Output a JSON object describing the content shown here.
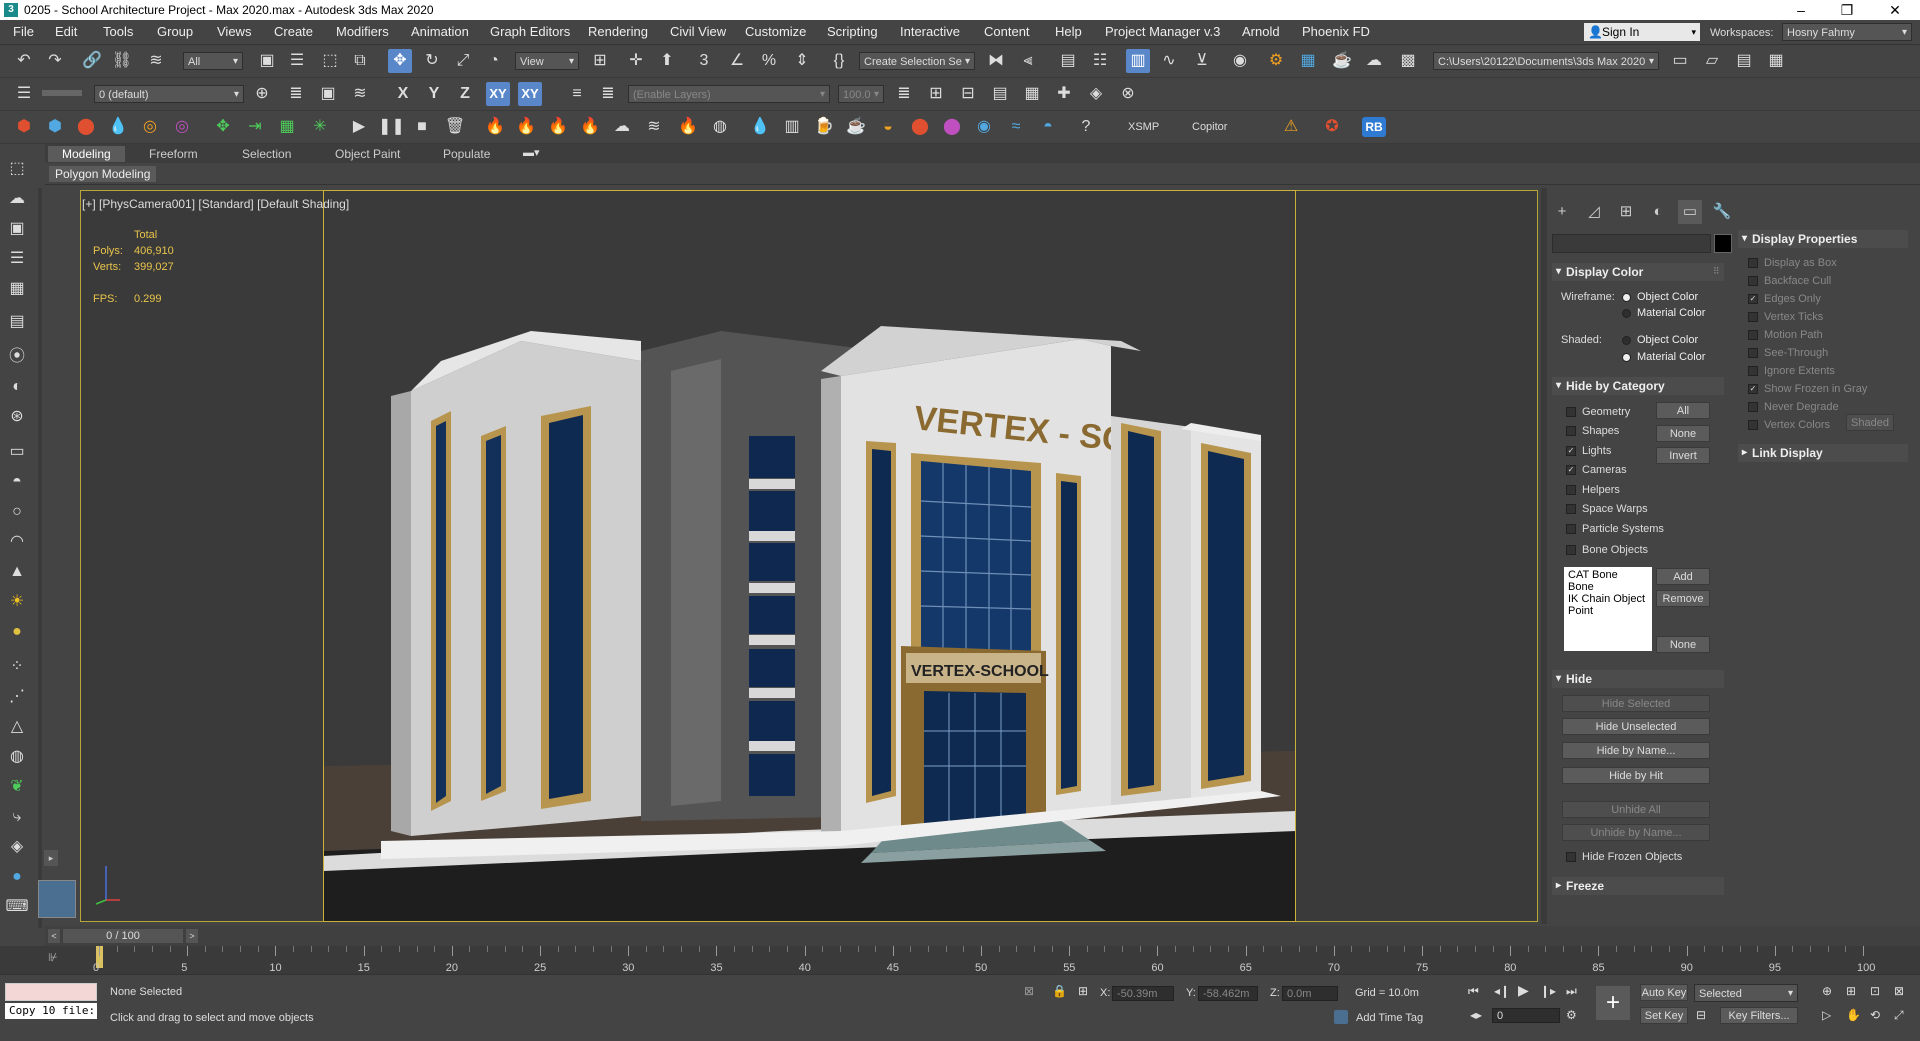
{
  "window": {
    "title": "0205 - School Architecture Project - Max 2020.max - Autodesk 3ds Max 2020",
    "controls": [
      "–",
      "❐",
      "✕"
    ]
  },
  "menu": [
    "File",
    "Edit",
    "Tools",
    "Group",
    "Views",
    "Create",
    "Modifiers",
    "Animation",
    "Graph Editors",
    "Rendering",
    "Civil View",
    "Customize",
    "Scripting",
    "Interactive",
    "Content",
    "Help",
    "Project Manager v.3",
    "Arnold",
    "Phoenix FD"
  ],
  "account": {
    "signin": "Sign In",
    "workspaces_label": "Workspaces:",
    "workspace": "Hosny Fahmy"
  },
  "toolbar1": {
    "filter": "All",
    "ref_coord": "View",
    "selection_set": "Create Selection Se",
    "project_path": "C:\\Users\\20122\\Documents\\3ds Max 2020"
  },
  "toolbar2": {
    "layer": "0 (default)",
    "axis_x": "X",
    "axis_y": "Y",
    "axis_z": "Z",
    "axis_xy": "XY",
    "axis_xy2": "XY",
    "enable_layers": "(Enable Layers)",
    "percent": "100.0"
  },
  "toolbar3": {
    "xsmp": "XSMP",
    "copitor": "Copitor",
    "rb": "RB"
  },
  "ribbon": {
    "tabs": [
      "Modeling",
      "Freeform",
      "Selection",
      "Object Paint",
      "Populate"
    ],
    "sub_label": "Polygon Modeling"
  },
  "viewport": {
    "label": "[+] [PhysCamera001] [Standard] [Default Shading]",
    "stats": {
      "total_label": "Total",
      "polys_label": "Polys:",
      "polys": "406,910",
      "verts_label": "Verts:",
      "verts": "399,027",
      "fps_label": "FPS:",
      "fps": "0.299"
    },
    "building_sign": "VERTEX - SCHOOL",
    "entrance_sign": "VERTEX-SCHOOL"
  },
  "command_panel": {
    "display_color": {
      "title": "Display Color",
      "wireframe_label": "Wireframe:",
      "shaded_label": "Shaded:",
      "object_color": "Object Color",
      "material_color": "Material Color"
    },
    "hide_by_category": {
      "title": "Hide by Category",
      "items": [
        {
          "label": "Geometry",
          "checked": false
        },
        {
          "label": "Shapes",
          "checked": false
        },
        {
          "label": "Lights",
          "checked": true
        },
        {
          "label": "Cameras",
          "checked": true
        },
        {
          "label": "Helpers",
          "checked": false
        },
        {
          "label": "Space Warps",
          "checked": false
        },
        {
          "label": "Particle Systems",
          "checked": false
        },
        {
          "label": "Bone Objects",
          "checked": false
        }
      ],
      "all": "All",
      "none": "None",
      "invert": "Invert",
      "list": [
        "CAT Bone",
        "Bone",
        "IK Chain Object",
        "Point"
      ],
      "add": "Add",
      "remove": "Remove",
      "none2": "None"
    },
    "hide": {
      "title": "Hide",
      "hide_selected": "Hide Selected",
      "hide_unselected": "Hide Unselected",
      "hide_by_name": "Hide by Name...",
      "hide_by_hit": "Hide by Hit",
      "unhide_all": "Unhide All",
      "unhide_by_name": "Unhide by Name...",
      "hide_frozen": "Hide Frozen Objects"
    },
    "freeze": {
      "title": "Freeze"
    },
    "display_properties": {
      "title": "Display Properties",
      "items": [
        {
          "label": "Display as Box",
          "checked": false
        },
        {
          "label": "Backface Cull",
          "checked": false
        },
        {
          "label": "Edges Only",
          "checked": true
        },
        {
          "label": "Vertex Ticks",
          "checked": false
        },
        {
          "label": "Motion Path",
          "checked": false
        },
        {
          "label": "See-Through",
          "checked": false
        },
        {
          "label": "Ignore Extents",
          "checked": false
        },
        {
          "label": "Show Frozen in Gray",
          "checked": true
        },
        {
          "label": "Never Degrade",
          "checked": false
        },
        {
          "label": "Vertex Colors",
          "checked": false
        }
      ],
      "shaded_btn": "Shaded"
    },
    "link_display": {
      "title": "Link Display"
    }
  },
  "timeline": {
    "frame": "0 / 100",
    "ticks": [
      "0",
      "5",
      "10",
      "15",
      "20",
      "25",
      "30",
      "35",
      "40",
      "45",
      "50",
      "55",
      "60",
      "65",
      "70",
      "75",
      "80",
      "85",
      "90",
      "95",
      "100"
    ]
  },
  "status": {
    "maxscript": "Copy 10 file:",
    "selection": "None Selected",
    "prompt": "Click and drag to select and move objects",
    "x_label": "X:",
    "x": "-50.39m",
    "y_label": "Y:",
    "y": "-58.462m",
    "z_label": "Z:",
    "z": "0.0m",
    "grid": "Grid = 10.0m",
    "add_time_tag": "Add Time Tag",
    "auto_key": "Auto Key",
    "set_key": "Set Key",
    "selected": "Selected",
    "key_filters": "Key Filters...",
    "frame_value": "0"
  }
}
